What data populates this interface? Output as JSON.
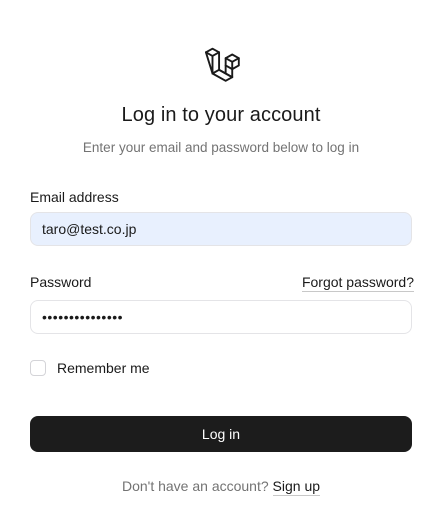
{
  "brand": {
    "logo_icon": "laravel-logo-icon"
  },
  "header": {
    "title": "Log in to your account",
    "subtitle": "Enter your email and password below to log in"
  },
  "form": {
    "email_label": "Email address",
    "email_value": "taro@test.co.jp",
    "password_label": "Password",
    "password_masked": "•••••••••••••••",
    "forgot_link": "Forgot password?",
    "remember_label": "Remember me",
    "remember_checked": false,
    "submit_label": "Log in"
  },
  "footer": {
    "prompt": "Don't have an account?",
    "signup_link": "Sign up"
  },
  "colors": {
    "button_bg": "#1c1c1c",
    "autofill_bg": "#e8f0fe",
    "muted_text": "#737373"
  }
}
